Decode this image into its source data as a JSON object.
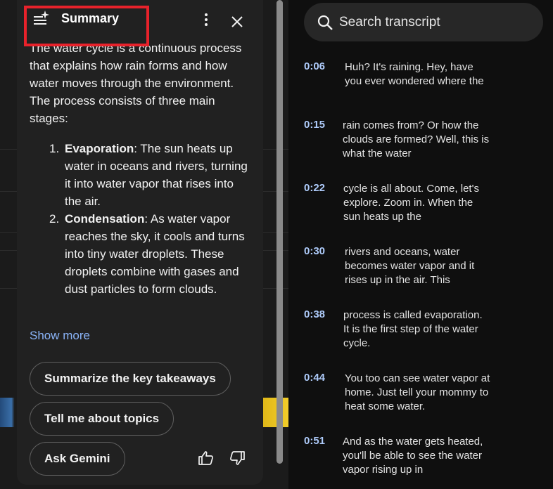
{
  "summary": {
    "title": "Summary",
    "intro": "The water cycle is a continuous process that explains how rain forms and how water moves through the environment. The process consists of three main stages:",
    "stages": [
      {
        "num": "1.",
        "term": "Evaporation",
        "text": ": The sun heats up water in oceans and rivers, turning it into water vapor that rises into the air."
      },
      {
        "num": "2.",
        "term": "Condensation",
        "text": ": As water vapor reaches the sky, it cools and turns into tiny water droplets. These droplets combine with gases and dust particles to form clouds."
      }
    ],
    "show_more": "Show more",
    "chips": [
      "Summarize the key takeaways",
      "Tell me about topics",
      "Ask Gemini"
    ]
  },
  "transcript": {
    "search_placeholder": "Search transcript",
    "segments": [
      {
        "time": "0:06",
        "text": "Huh? It's raining. Hey, have you ever wondered where the"
      },
      {
        "time": "0:15",
        "text": "rain comes from? Or how the clouds are formed? Well, this is what the water"
      },
      {
        "time": "0:22",
        "text": "cycle is all about. Come, let's explore. Zoom in. When the sun heats up the"
      },
      {
        "time": "0:30",
        "text": "rivers and oceans, water becomes water vapor and it rises up in the air. This"
      },
      {
        "time": "0:38",
        "text": "process is called evaporation. It is the first step of the water cycle."
      },
      {
        "time": "0:44",
        "text": "You too can see water vapor at home. Just tell your mommy to heat some water."
      },
      {
        "time": "0:51",
        "text": "And as the water gets heated, you'll be able to see the water vapor rising up in"
      }
    ]
  },
  "colors": {
    "accent_link": "#8ab4f8",
    "timestamp": "#aecbfa",
    "highlight": "#e8222b"
  }
}
